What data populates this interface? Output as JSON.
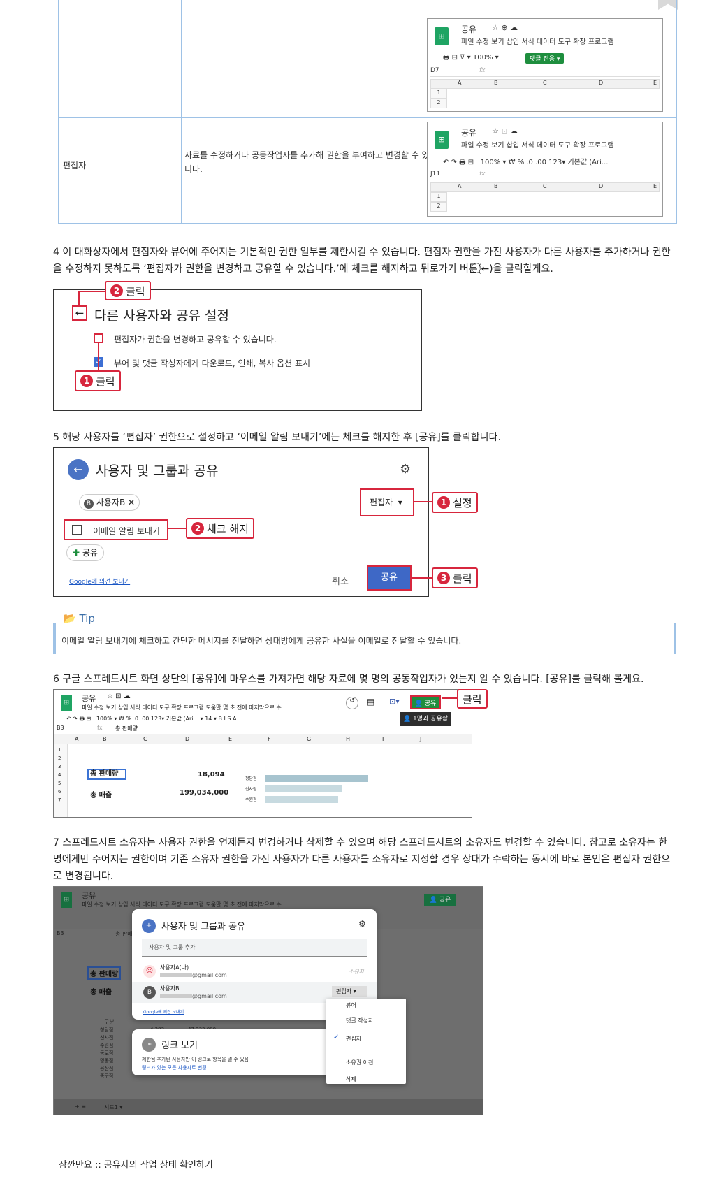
{
  "table": {
    "row2_role": "편집자",
    "row2_desc_line1": "자료를 수정하거나 공동작업자를 추가해 권한을 부여하고 변경할 수 있습",
    "row2_desc_line2": "니다.",
    "sheet1": {
      "title": "공유",
      "menu": "파일   수정   보기   삽입   서식   데이터   도구   확장 프로그램",
      "toolbar": "100%",
      "comment_btn": "댓글 전용 ▾",
      "cellref": "D7",
      "cols": [
        "A",
        "B",
        "C",
        "D",
        "E"
      ],
      "rows": [
        "1",
        "2"
      ]
    },
    "sheet2": {
      "title": "공유",
      "menu": "파일   수정   보기   삽입   서식   데이터   도구   확장 프로그램",
      "toolbar": "100%  ▾   ₩   %   .0   .00   123▾     기본값 (Ari...",
      "cellref": "J11",
      "cols": [
        "A",
        "B",
        "C",
        "D",
        "E"
      ],
      "rows": [
        "1",
        "2"
      ]
    }
  },
  "step4": {
    "text": "4 이 대화상자에서 편집자와 뷰어에 주어지는 기본적인 권한 일부를 제한시킬 수 있습니다. 편집자 권한을 가진 사용자가 다른 사용자를 추가하거나 권한을 수정하지 못하도록 ‘편집자가 권한을 변경하고 공유할 수 있습니다.’에 체크를 해지하고 뒤로가기 버튼(⃝←)을 클릭할게요.",
    "dialog_title": "다른 사용자와 공유 설정",
    "opt1": "편집자가 권한을 변경하고 공유할 수 있습니다.",
    "opt2": "뷰어 및 댓글 작성자에게 다운로드, 인쇄, 복사 옵션 표시",
    "callout1": "클릭",
    "callout2": "클릭"
  },
  "step5": {
    "text": "5 해당 사용자를 ‘편집자’ 권한으로 설정하고 ‘이메일 알림 보내기’에는 체크를 해지한 후 [공유]를 클릭합니다.",
    "dialog_title": "사용자 및 그룹과 공유",
    "chip": "사용자B",
    "role": "편집자",
    "notify": "이메일 알림 보내기",
    "share_small": "공유",
    "feedback": "Google에 의견 보내기",
    "cancel": "취소",
    "share": "공유",
    "callout1": "설정",
    "callout2": "체크 해지",
    "callout3": "클릭"
  },
  "tip": {
    "label": "Tip",
    "text": "이메일 알림 보내기에 체크하고 간단한 메시지를 전달하면 상대방에게 공유한 사실을 이메일로 전달할 수 있습니다."
  },
  "step6": {
    "text": "6 구글 스프레드시트 화면 상단의 [공유]에 마우스를 가져가면 해당 자료에 몇 명의 공동작업자가 있는지 알 수 있습니다. [공유]를 클릭해 볼게요.",
    "title": "공유",
    "menu": "파일  수정  보기  삽입  서식  데이터  도구  확장 프로그램  도움말   몇 초 전에 마지막으로 수...",
    "toolbar": "100%  ▾   ₩   %   .0   .00  123▾    기본값 (Ari...  ▾   14   ▾    B   I   S   A",
    "cellref": "B3",
    "formula": "총 판매량",
    "share_btn": "공유",
    "tooltip": "1명과 공유함",
    "callout": "클릭",
    "cols": [
      "A",
      "B",
      "C",
      "D",
      "E",
      "F",
      "G",
      "H",
      "I",
      "J"
    ],
    "rows": [
      "1",
      "2",
      "3",
      "4",
      "5",
      "6",
      "7"
    ],
    "label_total_sales": "총 판매량",
    "value_total_sales": "18,094",
    "label_revenue": "총 매출",
    "value_revenue": "199,034,000",
    "bars": [
      {
        "name": "청담점",
        "value": 1.0
      },
      {
        "name": "신사점",
        "value": 0.74
      },
      {
        "name": "수원점",
        "value": 0.71
      }
    ]
  },
  "step7": {
    "text": "7 스프레드시트 소유자는 사용자 권한을 언제든지 변경하거나 삭제할 수 있으며 해당 스프레드시트의 소유자도 변경할 수 있습니다. 참고로 소유자는 한 명에게만 주어지는 권한이며 기존 소유자 권한을 가진 사용자가 다른 사용자를 소유자로 지정할 경우 상대가 수락하는 동시에 바로 본인은 편집자 권한으로 변경됩니다.",
    "dialog_title": "사용자 및 그룹과 공유",
    "add_placeholder": "사용자 및 그룹 추가",
    "userA": "사용자A(나)",
    "userA_email": "@gmail.com",
    "userA_role": "소유자",
    "userB": "사용자B",
    "userB_email": "@gmail.com",
    "userB_role": "편집자",
    "feedback": "Google에 의견 보내기",
    "link_title": "링크 보기",
    "link_desc": "제한됨 추가된 사용자만 이 링크로 항목을 열 수 있음",
    "link_change": "링크가 있는 모든 사용자로 변경",
    "menu_items": [
      "뷰어",
      "댓글 작성자",
      "편집자",
      "소유권 이전",
      "삭제"
    ],
    "bg_title": "공유",
    "bg_menu": "파일  수정  보기  삽입  서식  데이터  도구  확장 프로그램  도움말   몇 초 전에 마지막으로 수...",
    "bg_cellref": "B3",
    "bg_formula": "총 판매",
    "bg_label1": "총 판매량",
    "bg_label2": "총 매출",
    "bg_list_header": "구분",
    "bg_list": [
      "청담점",
      "신사점",
      "수원점",
      "동로점",
      "명동점",
      "용산점",
      "종구점"
    ],
    "bg_sheet_tab": "시트1 ▾",
    "bg_value": "4,293",
    "bg_value2": "47,233,000"
  },
  "footer": "잠깐만요 :: 공유자의 작업 상태 확인하기"
}
